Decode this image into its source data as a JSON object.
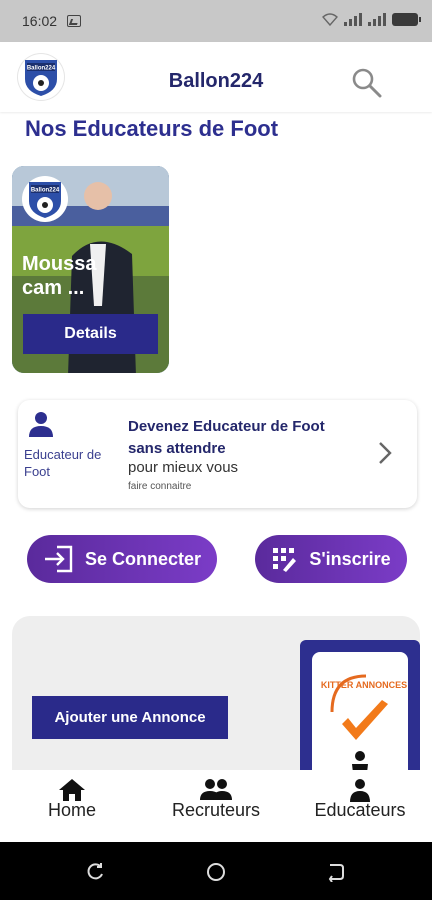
{
  "status_bar": {
    "time": "16:02"
  },
  "header": {
    "title": "Ballon224",
    "logo_text": "Ballon224"
  },
  "section_title": "Nos Educateurs de Foot",
  "educator_card": {
    "name": "Moussa\ncam ...",
    "details_label": "Details",
    "logo_text": "Ballon224"
  },
  "promo": {
    "side_label": "Educateur de Foot",
    "title": "Devenez Educateur de Foot  sans attendre",
    "subtitle": "pour mieux vous",
    "small": "faire connaitre"
  },
  "buttons": {
    "connect_label": "Se Connecter",
    "register_label": "S'inscrire"
  },
  "annonce": {
    "add_label": "Ajouter une Annonce",
    "badge_text": "KITTER ANNONCES"
  },
  "bottom_nav": {
    "items": [
      {
        "label": "Home",
        "icon": "home-icon"
      },
      {
        "label": "Recruteurs",
        "icon": "group-icon"
      },
      {
        "label": "Educateurs",
        "icon": "person-icon"
      }
    ]
  },
  "colors": {
    "primary": "#2d2f8f",
    "button_dark": "#2a2a8a",
    "pill_gradient_start": "#5a2a9c",
    "pill_gradient_end": "#7b3cc7"
  }
}
